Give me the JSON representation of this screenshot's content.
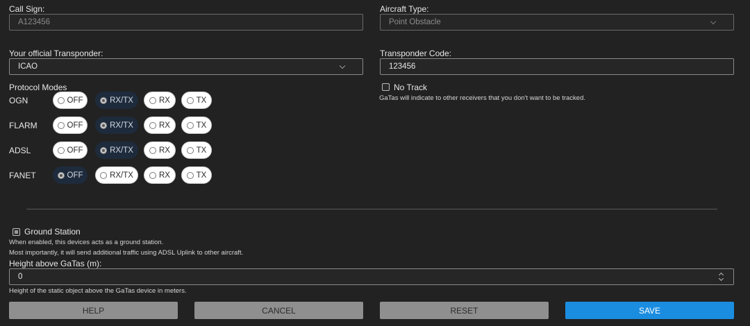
{
  "call_sign": {
    "label": "Call Sign:",
    "placeholder": "A123456"
  },
  "aircraft_type": {
    "label": "Aircraft Type:",
    "value": "Point Obstacle"
  },
  "transponder": {
    "label": "Your official Transponder:",
    "value": "ICAO"
  },
  "transponder_code": {
    "label": "Transponder Code:",
    "value": "123456"
  },
  "protocols": {
    "title": "Protocol Modes",
    "options": [
      "OFF",
      "RX/TX",
      "RX",
      "TX"
    ],
    "rows": [
      {
        "name": "OGN",
        "selected": "RX/TX"
      },
      {
        "name": "FLARM",
        "selected": "RX/TX"
      },
      {
        "name": "ADSL",
        "selected": "RX/TX"
      },
      {
        "name": "FANET",
        "selected": "OFF"
      }
    ]
  },
  "no_track": {
    "label": "No Track",
    "checked": false,
    "help": "GaTas will indicate to other receivers that you don't want to be tracked."
  },
  "ground_station": {
    "label": "Ground Station",
    "checked": true,
    "help1": "When enabled, this devices acts as a ground station.",
    "help2": "Most importantly, it will send additional traffic using ADSL Uplink to other aircraft."
  },
  "height": {
    "label": "Height above GaTas (m):",
    "value": "0",
    "help": "Height of the static object above the GaTas device in meters."
  },
  "buttons": {
    "help": "HELP",
    "cancel": "CANCEL",
    "reset": "RESET",
    "save": "SAVE"
  },
  "colors": {
    "background": "#222222",
    "accent": "#1b8de0",
    "selected_pill": "#1e2b3c",
    "button_grey": "#8f8f8f"
  }
}
